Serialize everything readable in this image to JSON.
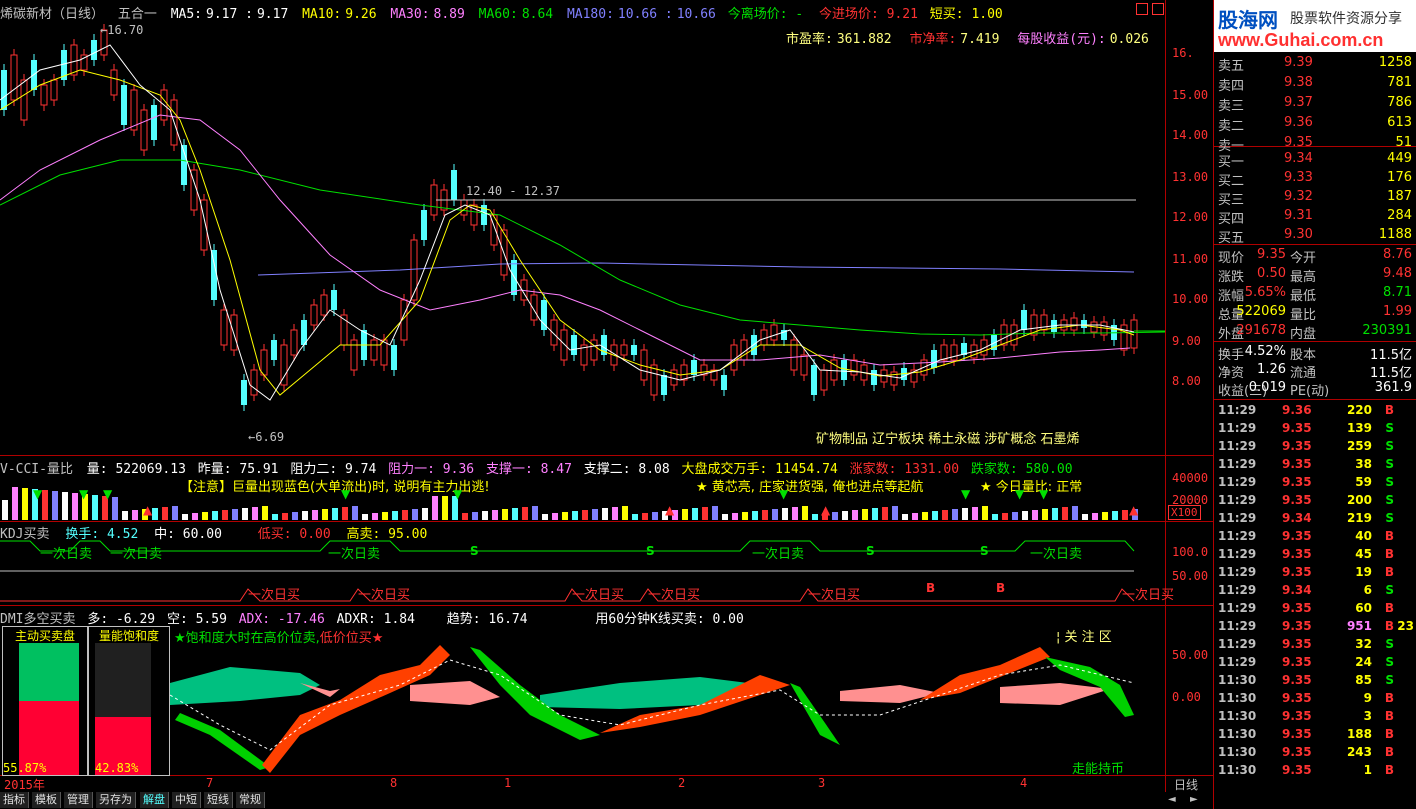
{
  "header": {
    "stock": "烯碳新材（日线）",
    "mode": "五合一",
    "ma5_label": "MA5:",
    "ma5": "9.17",
    "ma5b": "9.17",
    "ma10_label": "MA10:",
    "ma10": "9.26",
    "ma30_label": "MA30:",
    "ma30": "8.89",
    "ma60_label": "MA60:",
    "ma60": "8.64",
    "ma180_label": "MA180:",
    "ma180": "10.66",
    "ma180b": "10.66",
    "field1": "今离场价: -",
    "field2": "今进场价: 9.21",
    "field3": "短买: 1.00"
  },
  "info": {
    "pe_label": "市盈率:",
    "pe": "361.882",
    "pb_label": "市净率:",
    "pb": "7.419",
    "eps_label": "每股收益(元):",
    "eps": "0.026"
  },
  "price_chart": {
    "high_label": "16.70",
    "low_label": "6.69",
    "range_label": "12.40 - 12.37",
    "yaxis": [
      "16.",
      "15.00",
      "14.00",
      "13.00",
      "12.00",
      "11.00",
      "10.00",
      "9.00",
      "8.00"
    ],
    "concepts": "矿物制品  辽宁板块  稀土永磁  涉矿概念  石墨烯"
  },
  "vol_panel": {
    "title": "V-CCI-量比",
    "vol": "量: 522069.13",
    "prev": "昨量: 75.91",
    "r2": "阻力二: 9.74",
    "r1": "阻力一: 9.36",
    "s1": "支撑一: 8.47",
    "s2": "支撑二: 8.08",
    "mkt": "大盘成交万手: 11454.74",
    "up": "涨家数: 1331.00",
    "down": "跌家数: 580.00",
    "notice": "【注意】巨量出现蓝色(大单流出)时, 说明有主力出逃!",
    "tip": "★ 黄芯亮, 庄家进货强, 俺也进点等起航",
    "ratio": "★ 今日量比: 正常",
    "y1": "40000",
    "y2": "20000",
    "x100": "X100"
  },
  "kdj_panel": {
    "title": "KDJ买卖",
    "hs": "换手: 4.52",
    "mid": "中: 60.00",
    "low": "低买: 0.00",
    "high": "高卖: 95.00",
    "y1": "100.0",
    "y2": "50.00",
    "sell_label": "一次日卖",
    "buy_label": "一次日买",
    "s": "S",
    "b": "B"
  },
  "dmi_panel": {
    "title": "DMI多空买卖",
    "duo": "多: -6.29",
    "kong": "空: 5.59",
    "adx": "ADX: -17.46",
    "adxr": "ADXR: 1.84",
    "trend": "趋势: 16.74",
    "k60": "用60分钟K线买卖: 0.00",
    "box1": "主动买卖盘",
    "box2": "量能饱和度",
    "pct1": "55.87%",
    "pct2": "42.83%",
    "tip1": "★饱和度大时在高价位卖,",
    "tip2": "低价位买★",
    "focus": "关 注 区",
    "y1": "50.00",
    "y2": "0.00",
    "hold": "走能持币"
  },
  "xaxis": {
    "year": "2015年",
    "m7": "7",
    "m8": "8",
    "m1": "1",
    "m2": "2",
    "m3": "3",
    "m4": "4",
    "period": "日线"
  },
  "bottom_tabs": [
    "指标",
    "模板",
    "管理",
    "另存为",
    "解盘",
    "中短",
    "短线",
    "常规"
  ],
  "logo": {
    "name": "股海网",
    "slogan": "股票软件资源分享",
    "url": "www.Guhai.com.cn"
  },
  "order_book": {
    "sell": [
      {
        "label": "卖五",
        "price": "9.39",
        "vol": "1258"
      },
      {
        "label": "卖四",
        "price": "9.38",
        "vol": "781"
      },
      {
        "label": "卖三",
        "price": "9.37",
        "vol": "786"
      },
      {
        "label": "卖二",
        "price": "9.36",
        "vol": "613"
      },
      {
        "label": "卖一",
        "price": "9.35",
        "vol": "51"
      }
    ],
    "buy": [
      {
        "label": "买一",
        "price": "9.34",
        "vol": "449"
      },
      {
        "label": "买二",
        "price": "9.33",
        "vol": "176"
      },
      {
        "label": "买三",
        "price": "9.32",
        "vol": "187"
      },
      {
        "label": "买四",
        "price": "9.31",
        "vol": "284"
      },
      {
        "label": "买五",
        "price": "9.30",
        "vol": "1188"
      }
    ]
  },
  "quote": [
    {
      "l1": "现价",
      "v1": "9.35",
      "l2": "今开",
      "v2": "8.76"
    },
    {
      "l1": "涨跌",
      "v1": "0.50",
      "l2": "最高",
      "v2": "9.48"
    },
    {
      "l1": "涨幅",
      "v1": "5.65%",
      "l2": "最低",
      "v2": "8.71"
    },
    {
      "l1": "总量",
      "v1": "522069",
      "l2": "量比",
      "v2": "1.99"
    },
    {
      "l1": "外盘",
      "v1": "291678",
      "l2": "内盘",
      "v2": "230391"
    }
  ],
  "stats": [
    {
      "l1": "换手",
      "v1": "4.52%",
      "l2": "股本",
      "v2": "11.5亿"
    },
    {
      "l1": "净资",
      "v1": "1.26",
      "l2": "流通",
      "v2": "11.5亿"
    },
    {
      "l1": "收益(三)",
      "v1": "0.019",
      "l2": "PE(动)",
      "v2": "361.9"
    }
  ],
  "ticks": [
    {
      "t": "11:29",
      "p": "9.36",
      "v": "220",
      "d": "B"
    },
    {
      "t": "11:29",
      "p": "9.35",
      "v": "139",
      "d": "S"
    },
    {
      "t": "11:29",
      "p": "9.35",
      "v": "259",
      "d": "S"
    },
    {
      "t": "11:29",
      "p": "9.35",
      "v": "38",
      "d": "S"
    },
    {
      "t": "11:29",
      "p": "9.35",
      "v": "59",
      "d": "S"
    },
    {
      "t": "11:29",
      "p": "9.35",
      "v": "200",
      "d": "S"
    },
    {
      "t": "11:29",
      "p": "9.34",
      "v": "219",
      "d": "S"
    },
    {
      "t": "11:29",
      "p": "9.35",
      "v": "40",
      "d": "B"
    },
    {
      "t": "11:29",
      "p": "9.35",
      "v": "45",
      "d": "B"
    },
    {
      "t": "11:29",
      "p": "9.35",
      "v": "19",
      "d": "B"
    },
    {
      "t": "11:29",
      "p": "9.34",
      "v": "6",
      "d": "S"
    },
    {
      "t": "11:29",
      "p": "9.35",
      "v": "60",
      "d": "B"
    },
    {
      "t": "11:29",
      "p": "9.35",
      "v": "951",
      "d": "B",
      "x": "23"
    },
    {
      "t": "11:29",
      "p": "9.35",
      "v": "32",
      "d": "S"
    },
    {
      "t": "11:29",
      "p": "9.35",
      "v": "24",
      "d": "S"
    },
    {
      "t": "11:30",
      "p": "9.35",
      "v": "85",
      "d": "S"
    },
    {
      "t": "11:30",
      "p": "9.35",
      "v": "9",
      "d": "B"
    },
    {
      "t": "11:30",
      "p": "9.35",
      "v": "3",
      "d": "B"
    },
    {
      "t": "11:30",
      "p": "9.35",
      "v": "188",
      "d": "B"
    },
    {
      "t": "11:30",
      "p": "9.35",
      "v": "243",
      "d": "B"
    },
    {
      "t": "11:30",
      "p": "9.35",
      "v": "1",
      "d": "B"
    }
  ],
  "colors": {
    "up": "#ff3232",
    "down": "#54ffff",
    "panel_line": "#b00000",
    "ma5": "#ffffff",
    "ma10": "#ffff00",
    "ma30": "#ff80ff",
    "ma60": "#00e000",
    "ma180": "#8080ff"
  }
}
